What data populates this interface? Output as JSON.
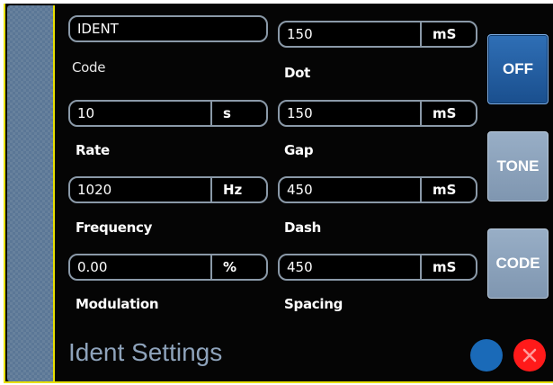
{
  "fields": {
    "code": {
      "value": "IDENT",
      "label": "Code"
    },
    "rate": {
      "value": "10",
      "unit": "s",
      "label": "Rate"
    },
    "frequency": {
      "value": "1020",
      "unit": "Hz",
      "label": "Frequency"
    },
    "modulation": {
      "value": "0.00",
      "unit": "%",
      "label": "Modulation"
    },
    "dot": {
      "value": "150",
      "unit": "mS",
      "label": "Dot"
    },
    "gap": {
      "value": "150",
      "unit": "mS",
      "label": "Gap"
    },
    "dash": {
      "value": "450",
      "unit": "mS",
      "label": "Dash"
    },
    "spacing": {
      "value": "450",
      "unit": "mS",
      "label": "Spacing"
    }
  },
  "buttons": {
    "off": "OFF",
    "tone": "TONE",
    "code": "CODE"
  },
  "title": "Ident Settings",
  "colors": {
    "accent_yellow": "#e8e000",
    "off_blue": "#1a4f8e",
    "status_blue": "#1a6ab8",
    "close_red": "#ff1a1a"
  },
  "icons": {
    "status": "blue-circle-icon",
    "close": "close-icon"
  }
}
